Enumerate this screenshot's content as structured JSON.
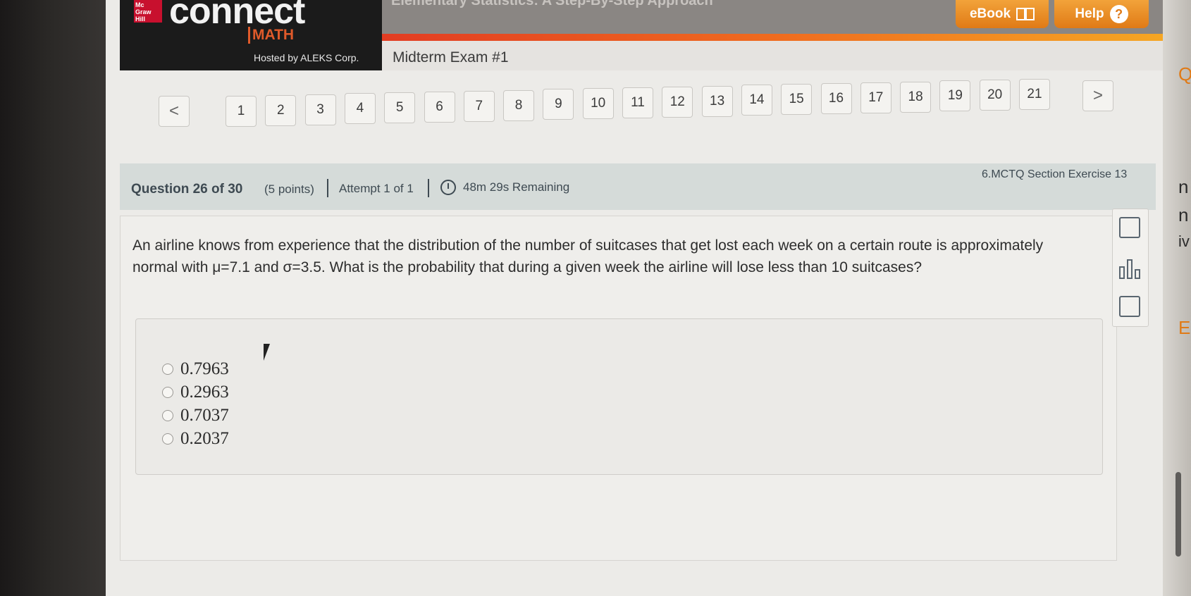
{
  "header": {
    "logo_text": "Mc Graw Hill",
    "brand": "connect",
    "subbrand": "MATH",
    "hosted_by": "Hosted by ALEKS Corp.",
    "book_title": "Elementary Statistics: A Step-By-Step Approach",
    "ebook_label": "eBook",
    "help_label": "Help",
    "help_symbol": "?"
  },
  "exam": {
    "title": "Midterm Exam #1"
  },
  "nav": {
    "prev": "<",
    "next": ">",
    "questions": [
      "1",
      "2",
      "3",
      "4",
      "5",
      "6",
      "7",
      "8",
      "9",
      "10",
      "11",
      "12",
      "13",
      "14",
      "15",
      "16",
      "17",
      "18",
      "19",
      "20",
      "21"
    ]
  },
  "question_bar": {
    "title": "Question 26 of 30",
    "points": "(5 points)",
    "attempt": "Attempt 1 of 1",
    "time_remaining": "48m 29s Remaining",
    "section": "6.MCTQ Section Exercise 13"
  },
  "question": {
    "text": "An airline knows from experience that the distribution of the number of suitcases that get lost each week on a certain route is approximately normal with μ=7.1 and σ=3.5. What is the probability that during a given week the airline will lose less than 10 suitcases?",
    "options": [
      "0.7963",
      "0.2963",
      "0.7037",
      "0.2037"
    ]
  },
  "edge_letters": [
    "Q",
    "n",
    "n",
    "iv",
    "E"
  ],
  "colors": {
    "accent": "#ef6b1f",
    "header_dark": "#1b1b1b",
    "qbar": "#d5dbd9"
  }
}
